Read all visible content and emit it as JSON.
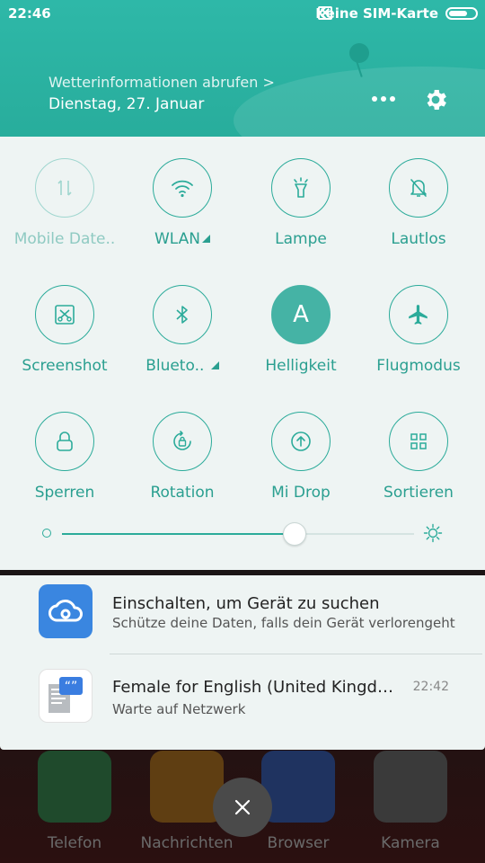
{
  "status_bar": {
    "time": "22:46",
    "sim_status": "Keine SIM-Karte"
  },
  "header": {
    "weather_link": "Wetterinformationen abrufen >",
    "date": "Dienstag, 27. Januar"
  },
  "tiles": [
    {
      "label": "Mobile Date..",
      "icon": "mobile-data-icon",
      "state": "disabled"
    },
    {
      "label": "WLAN",
      "icon": "wifi-icon",
      "state": "off",
      "has_menu": true
    },
    {
      "label": "Lampe",
      "icon": "flashlight-icon",
      "state": "off"
    },
    {
      "label": "Lautlos",
      "icon": "silent-bell-icon",
      "state": "off"
    },
    {
      "label": "Screenshot",
      "icon": "screenshot-scissors-icon",
      "state": "off"
    },
    {
      "label": "Blueto..",
      "icon": "bluetooth-icon",
      "state": "off",
      "has_menu": true
    },
    {
      "label": "Helligkeit",
      "icon": "auto-brightness-icon",
      "state": "on",
      "glyph": "A"
    },
    {
      "label": "Flugmodus",
      "icon": "airplane-icon",
      "state": "off"
    },
    {
      "label": "Sperren",
      "icon": "lock-icon",
      "state": "off"
    },
    {
      "label": "Rotation",
      "icon": "rotation-lock-icon",
      "state": "off"
    },
    {
      "label": "Mi Drop",
      "icon": "upload-icon",
      "state": "off"
    },
    {
      "label": "Sortieren",
      "icon": "grid-icon",
      "state": "off"
    }
  ],
  "brightness": {
    "level": 0.66
  },
  "notifications": [
    {
      "title": "Einschalten, um Gerät zu suchen",
      "subtitle": "Schütze deine Daten, falls dein Gerät verlorengeht",
      "time": "",
      "icon": "cloud-icon"
    },
    {
      "title": "Female for English (United Kingdo...",
      "subtitle": "Warte auf Netzwerk",
      "time": "22:42",
      "icon": "tts-document-icon"
    }
  ],
  "dock": [
    {
      "label": "Telefon",
      "icon": "phone-icon",
      "color": "#2f6b3f"
    },
    {
      "label": "Nachrichten",
      "icon": "message-icon",
      "color": "#8a5a1a"
    },
    {
      "label": "Browser",
      "icon": "browser-icon",
      "color": "#2e4a8a"
    },
    {
      "label": "Kamera",
      "icon": "camera-icon",
      "color": "#505050"
    }
  ],
  "colors": {
    "accent": "#2bab9a",
    "header": "#2eb8a8",
    "panel": "#eef4f3"
  }
}
